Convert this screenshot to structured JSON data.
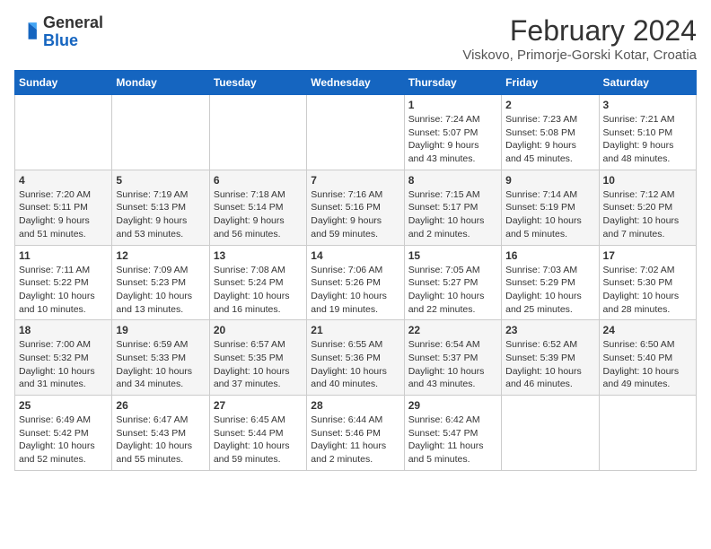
{
  "header": {
    "logo_general": "General",
    "logo_blue": "Blue",
    "month_title": "February 2024",
    "subtitle": "Viskovo, Primorje-Gorski Kotar, Croatia"
  },
  "days_of_week": [
    "Sunday",
    "Monday",
    "Tuesday",
    "Wednesday",
    "Thursday",
    "Friday",
    "Saturday"
  ],
  "weeks": [
    [
      {
        "day": "",
        "info": ""
      },
      {
        "day": "",
        "info": ""
      },
      {
        "day": "",
        "info": ""
      },
      {
        "day": "",
        "info": ""
      },
      {
        "day": "1",
        "info": "Sunrise: 7:24 AM\nSunset: 5:07 PM\nDaylight: 9 hours\nand 43 minutes."
      },
      {
        "day": "2",
        "info": "Sunrise: 7:23 AM\nSunset: 5:08 PM\nDaylight: 9 hours\nand 45 minutes."
      },
      {
        "day": "3",
        "info": "Sunrise: 7:21 AM\nSunset: 5:10 PM\nDaylight: 9 hours\nand 48 minutes."
      }
    ],
    [
      {
        "day": "4",
        "info": "Sunrise: 7:20 AM\nSunset: 5:11 PM\nDaylight: 9 hours\nand 51 minutes."
      },
      {
        "day": "5",
        "info": "Sunrise: 7:19 AM\nSunset: 5:13 PM\nDaylight: 9 hours\nand 53 minutes."
      },
      {
        "day": "6",
        "info": "Sunrise: 7:18 AM\nSunset: 5:14 PM\nDaylight: 9 hours\nand 56 minutes."
      },
      {
        "day": "7",
        "info": "Sunrise: 7:16 AM\nSunset: 5:16 PM\nDaylight: 9 hours\nand 59 minutes."
      },
      {
        "day": "8",
        "info": "Sunrise: 7:15 AM\nSunset: 5:17 PM\nDaylight: 10 hours\nand 2 minutes."
      },
      {
        "day": "9",
        "info": "Sunrise: 7:14 AM\nSunset: 5:19 PM\nDaylight: 10 hours\nand 5 minutes."
      },
      {
        "day": "10",
        "info": "Sunrise: 7:12 AM\nSunset: 5:20 PM\nDaylight: 10 hours\nand 7 minutes."
      }
    ],
    [
      {
        "day": "11",
        "info": "Sunrise: 7:11 AM\nSunset: 5:22 PM\nDaylight: 10 hours\nand 10 minutes."
      },
      {
        "day": "12",
        "info": "Sunrise: 7:09 AM\nSunset: 5:23 PM\nDaylight: 10 hours\nand 13 minutes."
      },
      {
        "day": "13",
        "info": "Sunrise: 7:08 AM\nSunset: 5:24 PM\nDaylight: 10 hours\nand 16 minutes."
      },
      {
        "day": "14",
        "info": "Sunrise: 7:06 AM\nSunset: 5:26 PM\nDaylight: 10 hours\nand 19 minutes."
      },
      {
        "day": "15",
        "info": "Sunrise: 7:05 AM\nSunset: 5:27 PM\nDaylight: 10 hours\nand 22 minutes."
      },
      {
        "day": "16",
        "info": "Sunrise: 7:03 AM\nSunset: 5:29 PM\nDaylight: 10 hours\nand 25 minutes."
      },
      {
        "day": "17",
        "info": "Sunrise: 7:02 AM\nSunset: 5:30 PM\nDaylight: 10 hours\nand 28 minutes."
      }
    ],
    [
      {
        "day": "18",
        "info": "Sunrise: 7:00 AM\nSunset: 5:32 PM\nDaylight: 10 hours\nand 31 minutes."
      },
      {
        "day": "19",
        "info": "Sunrise: 6:59 AM\nSunset: 5:33 PM\nDaylight: 10 hours\nand 34 minutes."
      },
      {
        "day": "20",
        "info": "Sunrise: 6:57 AM\nSunset: 5:35 PM\nDaylight: 10 hours\nand 37 minutes."
      },
      {
        "day": "21",
        "info": "Sunrise: 6:55 AM\nSunset: 5:36 PM\nDaylight: 10 hours\nand 40 minutes."
      },
      {
        "day": "22",
        "info": "Sunrise: 6:54 AM\nSunset: 5:37 PM\nDaylight: 10 hours\nand 43 minutes."
      },
      {
        "day": "23",
        "info": "Sunrise: 6:52 AM\nSunset: 5:39 PM\nDaylight: 10 hours\nand 46 minutes."
      },
      {
        "day": "24",
        "info": "Sunrise: 6:50 AM\nSunset: 5:40 PM\nDaylight: 10 hours\nand 49 minutes."
      }
    ],
    [
      {
        "day": "25",
        "info": "Sunrise: 6:49 AM\nSunset: 5:42 PM\nDaylight: 10 hours\nand 52 minutes."
      },
      {
        "day": "26",
        "info": "Sunrise: 6:47 AM\nSunset: 5:43 PM\nDaylight: 10 hours\nand 55 minutes."
      },
      {
        "day": "27",
        "info": "Sunrise: 6:45 AM\nSunset: 5:44 PM\nDaylight: 10 hours\nand 59 minutes."
      },
      {
        "day": "28",
        "info": "Sunrise: 6:44 AM\nSunset: 5:46 PM\nDaylight: 11 hours\nand 2 minutes."
      },
      {
        "day": "29",
        "info": "Sunrise: 6:42 AM\nSunset: 5:47 PM\nDaylight: 11 hours\nand 5 minutes."
      },
      {
        "day": "",
        "info": ""
      },
      {
        "day": "",
        "info": ""
      }
    ]
  ]
}
